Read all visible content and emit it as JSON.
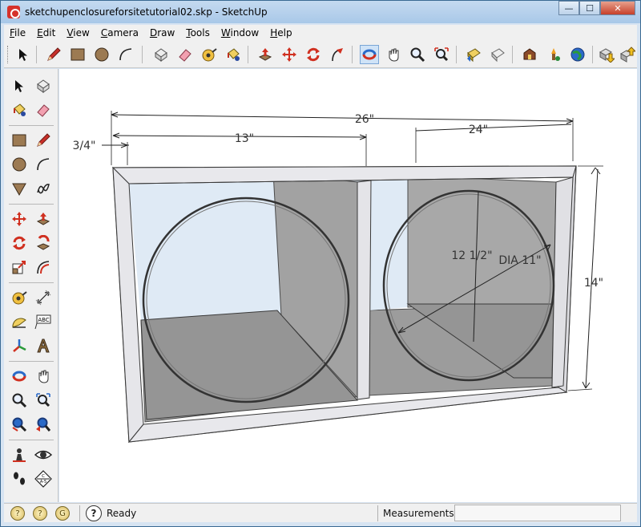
{
  "window": {
    "title": "sketchupenclosureforsitetutorial02.skp - SketchUp",
    "minimize_label": "—",
    "maximize_label": "☐",
    "close_label": "✕"
  },
  "menu": {
    "items": [
      "File",
      "Edit",
      "View",
      "Camera",
      "Draw",
      "Tools",
      "Window",
      "Help"
    ]
  },
  "toolbar_top": {
    "icons": [
      "select-icon",
      "pencil-icon",
      "rectangle-icon",
      "circle-icon",
      "arc-icon",
      "make-component-icon",
      "eraser-icon",
      "tape-measure-icon",
      "paint-bucket-icon",
      "push-pull-icon",
      "move-icon",
      "rotate-icon",
      "follow-me-icon",
      "orbit-icon",
      "pan-icon",
      "zoom-icon",
      "zoom-extents-icon",
      "previous-view-icon",
      "next-view-icon",
      "warehouse-icon",
      "components-icon",
      "google-earth-icon",
      "get-models-icon",
      "share-model-icon"
    ]
  },
  "toolbar_left": {
    "icons": [
      "select-icon",
      "make-component-icon",
      "paint-bucket-icon",
      "eraser-icon",
      "rectangle-icon",
      "pencil-icon",
      "circle-icon",
      "arc-icon",
      "polygon-icon",
      "freehand-icon",
      "move-icon",
      "push-pull-icon",
      "rotate-icon",
      "follow-me-icon",
      "scale-icon",
      "offset-icon",
      "tape-measure-icon",
      "dimension-icon",
      "protractor-icon",
      "text-icon",
      "axes-icon",
      "3d-text-icon",
      "orbit-icon",
      "pan-icon",
      "zoom-icon",
      "zoom-window-icon",
      "zoom-extents-icon",
      "previous-icon",
      "position-camera-icon",
      "look-around-icon",
      "walk-icon",
      "section-plane-icon"
    ],
    "text_tool_label": "ABC",
    "section_label": "C\nA-5"
  },
  "drawing": {
    "dim_overall": "26\"",
    "dim_left": "13\"",
    "dim_right": "24\"",
    "dim_thickness": "3/4\"",
    "dim_height": "14\"",
    "dim_radius": "12 1/2\"",
    "dim_diameter": "DIA 11\""
  },
  "statusbar": {
    "icon_labels": [
      "?",
      "?",
      "G"
    ],
    "status": "Ready",
    "measurements_label": "Measurements",
    "measurements_value": ""
  },
  "colors": {
    "title_bar": "#a9c8e8",
    "chrome": "#f0f0f0",
    "red_tool": "#d6322b",
    "panel_grey": "#9a9a9a"
  }
}
